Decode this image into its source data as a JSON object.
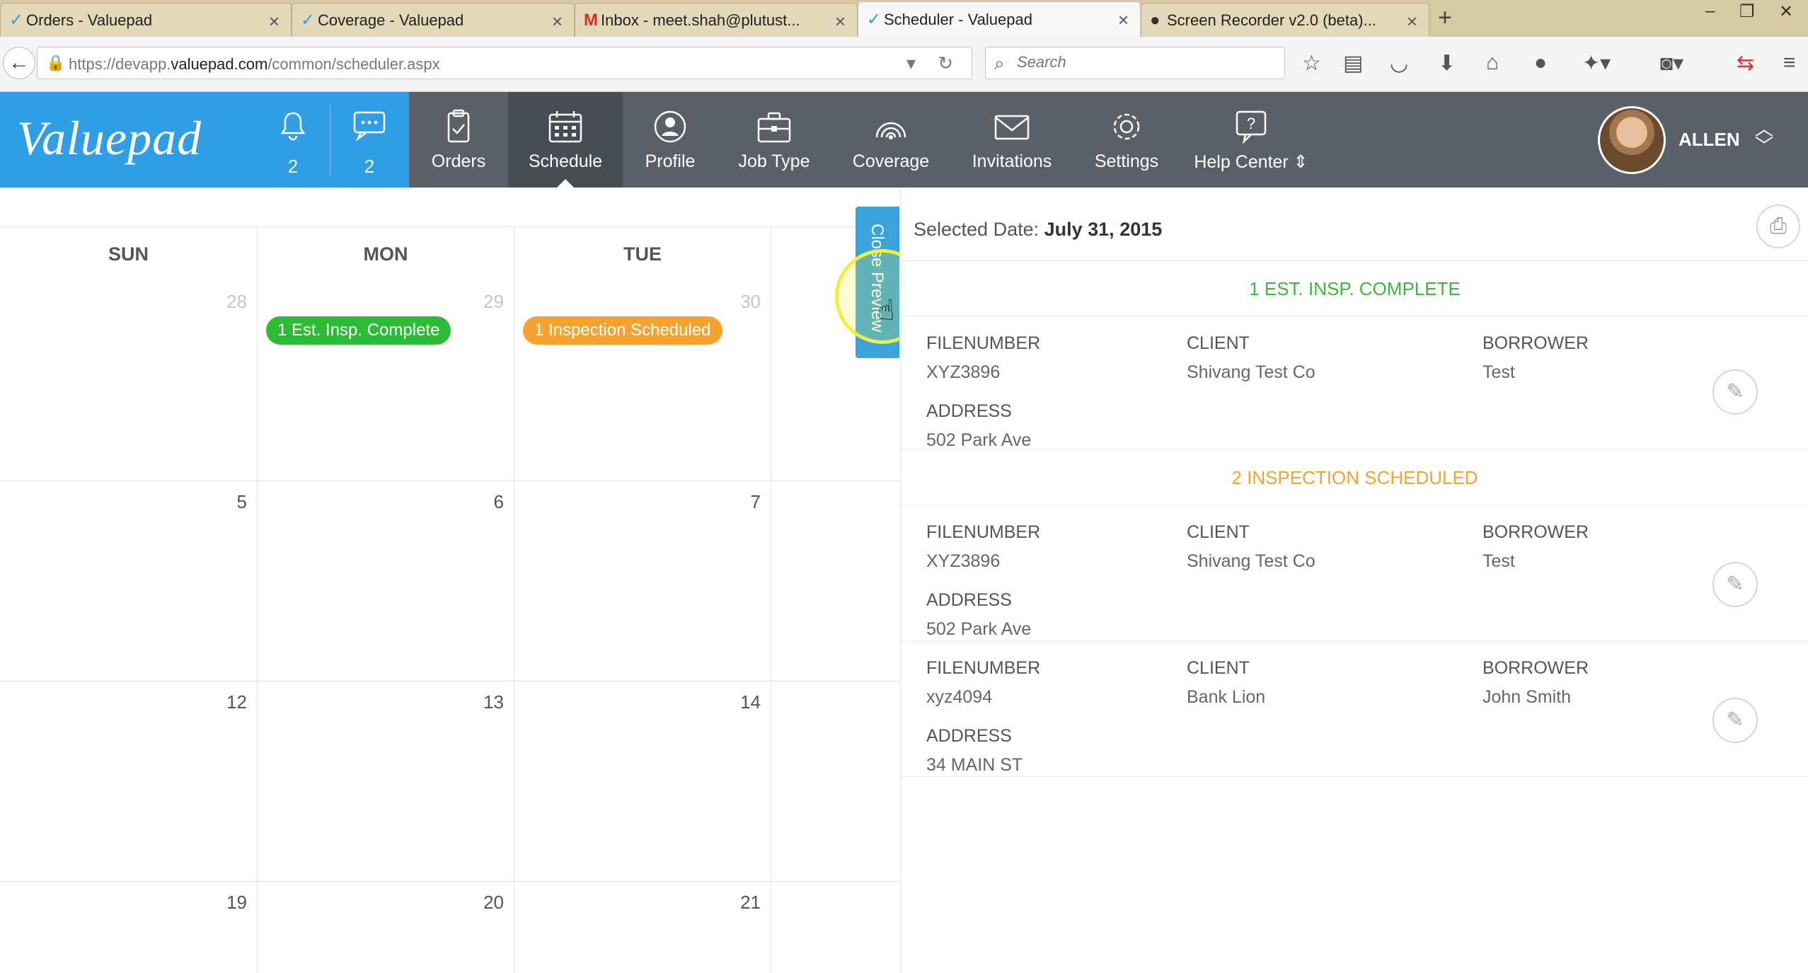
{
  "browser": {
    "tabs": [
      {
        "label": "Orders - Valuepad",
        "icon": "✓",
        "icon_color": "#2f9ee6"
      },
      {
        "label": "Coverage - Valuepad",
        "icon": "✓",
        "icon_color": "#2f9ee6"
      },
      {
        "label": "Inbox - meet.shah@plutust...",
        "icon": "M",
        "icon_color": "#d93025"
      },
      {
        "label": "Scheduler - Valuepad",
        "icon": "✓",
        "icon_color": "#2f9ee6",
        "active": true
      },
      {
        "label": "Screen Recorder v2.0 (beta)...",
        "icon": "●",
        "icon_color": "#333333"
      }
    ],
    "url_prefix": "https://devapp.",
    "url_domain": "valuepad.com",
    "url_suffix": "/common/scheduler.aspx",
    "search_placeholder": "Search"
  },
  "app": {
    "logo": "Valuepad",
    "notifications_count": "2",
    "messages_count": "2",
    "nav": [
      {
        "label": "Orders",
        "icon": "orders-icon"
      },
      {
        "label": "Schedule",
        "icon": "calendar-icon",
        "active": true
      },
      {
        "label": "Profile",
        "icon": "profile-icon"
      },
      {
        "label": "Job Type",
        "icon": "briefcase-icon"
      },
      {
        "label": "Coverage",
        "icon": "coverage-icon"
      },
      {
        "label": "Invitations",
        "icon": "envelope-icon"
      },
      {
        "label": "Settings",
        "icon": "gear-icon"
      },
      {
        "label": "Help Center",
        "icon": "help-icon"
      }
    ],
    "user_name": "ALLEN",
    "brand_color": "#2f9ee6",
    "header_color": "#5b5f67"
  },
  "calendar": {
    "days": [
      "SUN",
      "MON",
      "TUE"
    ],
    "weeks": [
      [
        "28",
        "29",
        "30"
      ],
      [
        "5",
        "6",
        "7"
      ],
      [
        "12",
        "13",
        "14"
      ],
      [
        "19",
        "20",
        "21"
      ]
    ],
    "events": {
      "mon_week1": "1 Est. Insp. Complete",
      "tue_week1": "1 Inspection Scheduled"
    },
    "close_preview": "Close Preview"
  },
  "preview": {
    "selected_date_label": "Selected Date:",
    "selected_date": "July 31, 2015",
    "labels": {
      "filenumber": "FILENUMBER",
      "client": "CLIENT",
      "borrower": "BORROWER",
      "address": "ADDRESS"
    },
    "section1_title": "1 EST. INSP. COMPLETE",
    "section2_title": "2 INSPECTION SCHEDULED",
    "records": [
      {
        "filenumber": "XYZ3896",
        "client": "Shivang Test Co",
        "borrower": "Test",
        "address": "502 Park Ave"
      },
      {
        "filenumber": "XYZ3896",
        "client": "Shivang Test Co",
        "borrower": "Test",
        "address": "502 Park Ave"
      },
      {
        "filenumber": "xyz4094",
        "client": "Bank Lion",
        "borrower": "John Smith",
        "address": "34 MAIN ST"
      }
    ]
  }
}
